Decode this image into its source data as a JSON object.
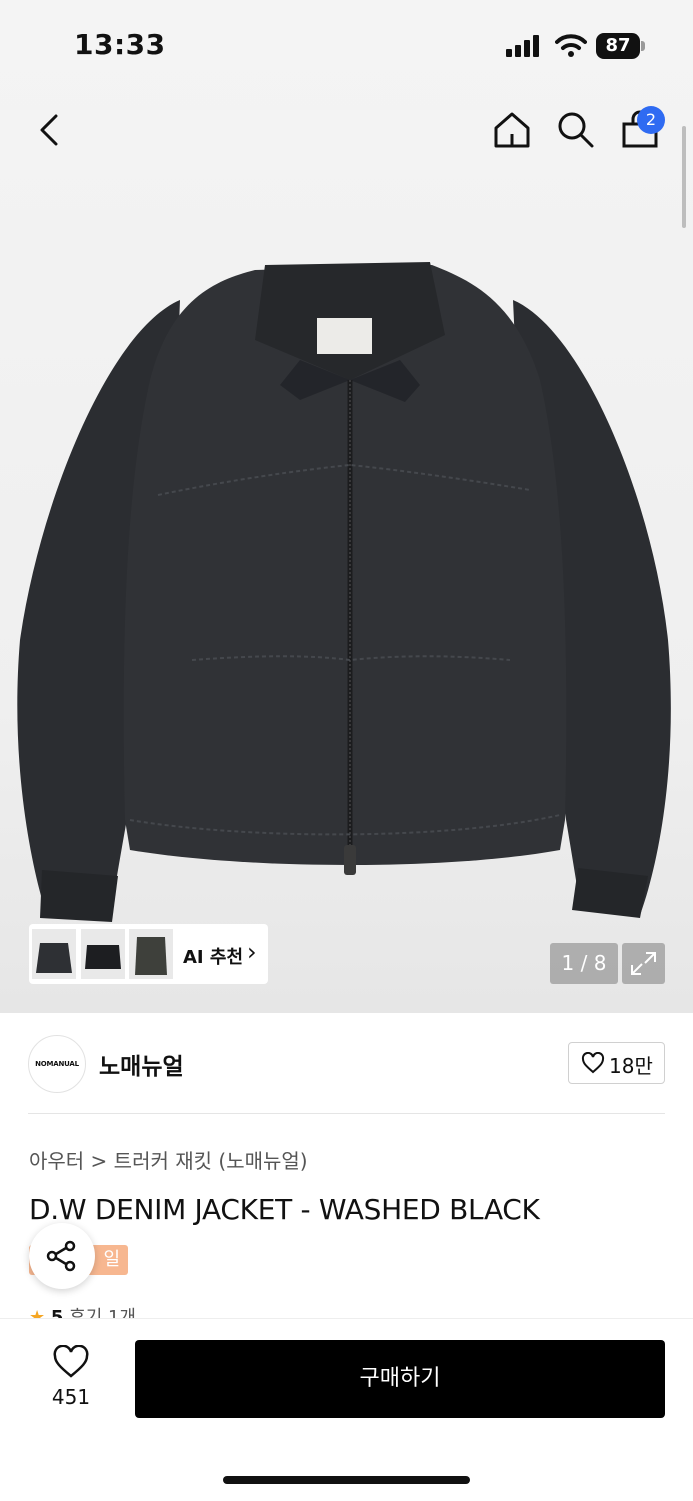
{
  "status_bar": {
    "time": "13:33",
    "battery": "87"
  },
  "header": {
    "cart_count": "2"
  },
  "gallery": {
    "ai_label": "AI 추천",
    "counter": "1 / 8",
    "ai_chevron": "›"
  },
  "brand": {
    "logo_text": "NOMANUAL",
    "name": "노매뉴얼",
    "likes": "18만"
  },
  "product": {
    "breadcrumb": "아우터 > 트러커 재킷 (노매뉴얼)",
    "title": "D.W DENIM JACKET - WASHED BLACK",
    "tag": "일",
    "rating": "5",
    "reviews": "후기 1개"
  },
  "bottom": {
    "wish_count": "451",
    "buy_label": "구매하기"
  },
  "colors": {
    "accent": "#2f6bf2",
    "tag": "#f7b790",
    "star": "#f5a623",
    "jacket": "#2d2f33"
  },
  "icons": [
    "back-icon",
    "home-icon",
    "search-icon",
    "bag-icon",
    "expand-icon",
    "heart-icon",
    "share-icon",
    "star-icon",
    "wifi-icon",
    "signal-icon"
  ]
}
